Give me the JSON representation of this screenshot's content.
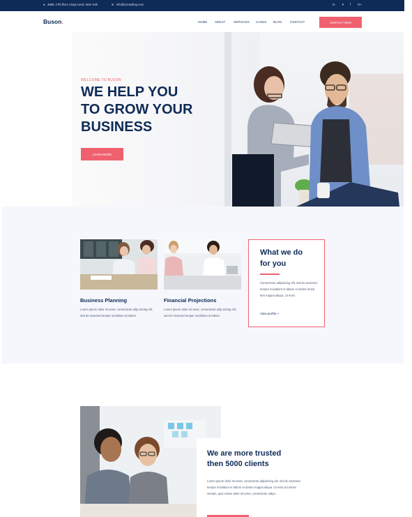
{
  "topbar": {
    "address": "4868, 17th floor, Kings Land, New York",
    "email": "info@consulting.com",
    "social": [
      {
        "icon": "linkedin-icon",
        "glyph": "in"
      },
      {
        "icon": "twitter-icon",
        "glyph": "✦"
      },
      {
        "icon": "facebook-icon",
        "glyph": "f"
      },
      {
        "icon": "googleplus-icon",
        "glyph": "G+"
      }
    ]
  },
  "brand": {
    "name": "Buson",
    "dot": "."
  },
  "nav": {
    "items": [
      "HOME",
      "ABOUT",
      "SERVICES",
      "CASES",
      "BLOG",
      "CONTACT"
    ],
    "cta": "CONTACT NOW"
  },
  "hero": {
    "welcome": "WELCOME TO BUSON",
    "heading": [
      "WE HELP YOU",
      "TO GROW YOUR",
      "BUSINESS"
    ],
    "button": "LEARN MORE"
  },
  "services": {
    "cards": [
      {
        "title": "Business Planning",
        "text": "Lorem ipsum dolor sit amet, consectetur adip isicing elit, sed do eiusmod tempor incididunt ut labore."
      },
      {
        "title": "Financial Projections",
        "text": "Lorem ipsum dolor sit amet, consectetur adip isicing elit, sed do eiusmod tempor incididunt ut labore."
      }
    ],
    "what": {
      "heading": [
        "What we do",
        "for you"
      ],
      "text": "Consectetur adipisicing elit, sed do eiusmod tempor incididunt ut labore et dolore smod tem magna aliqua. Ut enim.",
      "link": "View profile »"
    }
  },
  "trusted": {
    "heading": [
      "We are more trusted",
      "then 5000 clients"
    ],
    "text": "Lorem ipsum dolor sit amet, consectetur adipisicing elit, sed do eiusmod tempor incididunt ut labore et dolore magna aliqua. Ut enim ad minim veniam, quis nostru dolor sit amet, consectetur adipn."
  },
  "colors": {
    "navy": "#0e2a56",
    "accent": "#f0616f",
    "light_bg": "#f5f7fc"
  }
}
